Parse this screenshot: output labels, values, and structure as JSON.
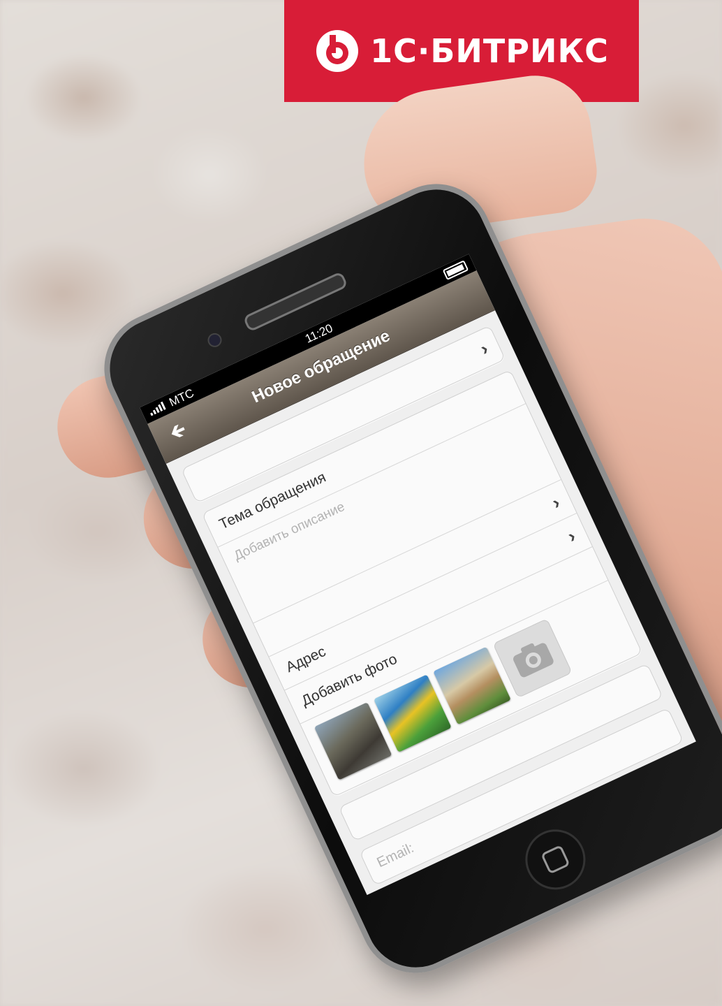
{
  "brand": {
    "name": "1С·БИТРИКС",
    "color": "#d81d37",
    "logo_icon": "bitrix-logo-icon"
  },
  "phone": {
    "status": {
      "carrier": "МТС",
      "time": "11:20"
    },
    "nav": {
      "title": "Новое обращение",
      "back_icon": "back-arrow-icon"
    },
    "form": {
      "top_row": "",
      "subject_label": "Тема обращения",
      "description_placeholder": "Добавить описание",
      "address_label": "Адрес",
      "add_photo_label": "Добавить фото",
      "email_placeholder": "Email:"
    }
  }
}
